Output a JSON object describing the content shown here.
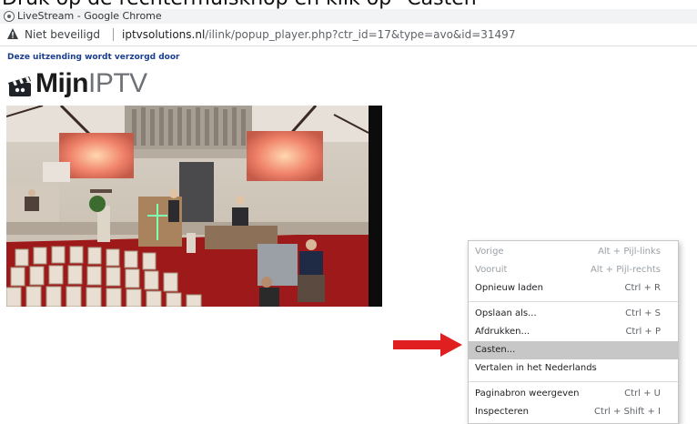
{
  "instruction": "Druk op de rechtermuisknop en klik op \"Casten\"",
  "window": {
    "title": "LiveStream - Google Chrome"
  },
  "addressbar": {
    "security_label": "Niet beveiligd",
    "url_domain": "iptvsolutions.nl",
    "url_path": "/ilink/popup_player.php?ctr_id=17&type=avo&id=31497"
  },
  "page": {
    "sponsor_text": "Deze uitzending wordt verzorgd door",
    "logo_bold": "Mijn",
    "logo_light": "IPTV"
  },
  "context_menu": {
    "items": [
      {
        "label": "Vorige",
        "shortcut": "Alt + Pijl-links",
        "disabled": true
      },
      {
        "label": "Vooruit",
        "shortcut": "Alt + Pijl-rechts",
        "disabled": true
      },
      {
        "label": "Opnieuw laden",
        "shortcut": "Ctrl + R",
        "disabled": false
      },
      {
        "label": "Opslaan als...",
        "shortcut": "Ctrl + S",
        "disabled": false
      },
      {
        "label": "Afdrukken...",
        "shortcut": "Ctrl + P",
        "disabled": false
      },
      {
        "label": "Casten...",
        "shortcut": "",
        "disabled": false,
        "highlighted": true
      },
      {
        "label": "Vertalen in het Nederlands",
        "shortcut": "",
        "disabled": false
      },
      {
        "label": "Paginabron weergeven",
        "shortcut": "Ctrl + U",
        "disabled": false
      },
      {
        "label": "Inspecteren",
        "shortcut": "Ctrl + Shift + I",
        "disabled": false
      }
    ]
  },
  "colors": {
    "arrow": "#e02020",
    "highlight": "#c7c7c7",
    "sponsor_link": "#1a3d8f"
  }
}
